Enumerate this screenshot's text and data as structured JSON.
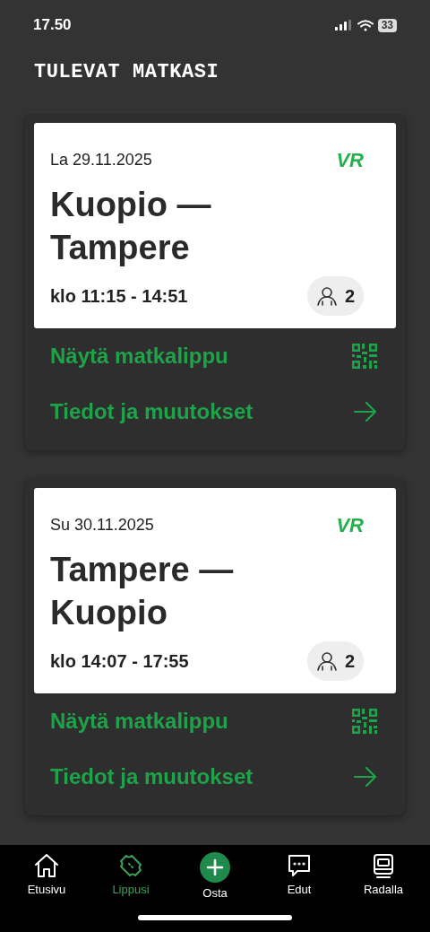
{
  "status_bar": {
    "time": "17.50",
    "battery": "33"
  },
  "title": "TULEVAT MATKASI",
  "trips": [
    {
      "date": "La 29.11.2025",
      "logo": "VR",
      "route": "Kuopio — Tampere",
      "time": "klo 11:15 - 14:51",
      "passengers": "2",
      "actions": [
        {
          "kind": "ticket",
          "label": "Näytä matkalippu"
        },
        {
          "kind": "details",
          "label": "Tiedot ja muutokset"
        }
      ]
    },
    {
      "date": "Su 30.11.2025",
      "logo": "VR",
      "route": "Tampere — Kuopio",
      "time": "klo 14:07 - 17:55",
      "passengers": "2",
      "actions": [
        {
          "kind": "ticket",
          "label": "Näytä matkalippu"
        },
        {
          "kind": "details",
          "label": "Tiedot ja muutokset"
        }
      ]
    }
  ],
  "nav": [
    {
      "kind": "home",
      "label": "Etusivu",
      "selected": false
    },
    {
      "kind": "ticket",
      "label": "Lippusi",
      "selected": true
    },
    {
      "kind": "buy",
      "label": "Osta",
      "selected": false
    },
    {
      "kind": "chat",
      "label": "Edut",
      "selected": false
    },
    {
      "kind": "train",
      "label": "Radalla",
      "selected": false
    }
  ]
}
